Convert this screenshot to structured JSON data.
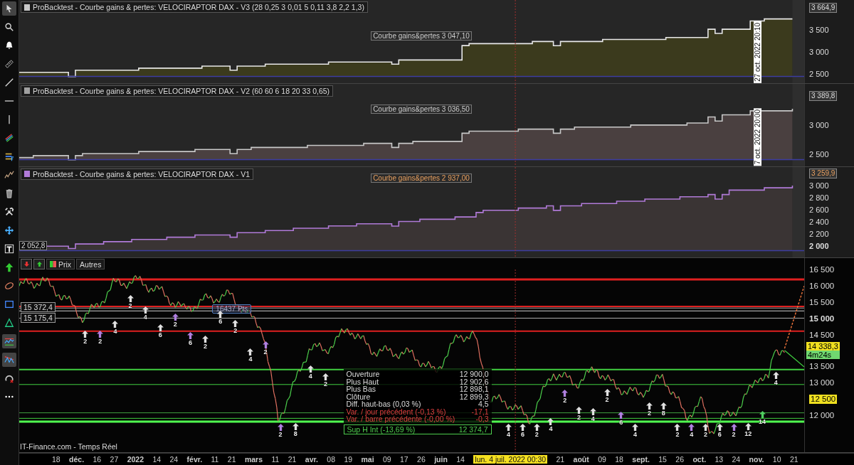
{
  "toolbar": [
    {
      "kind": "cursor",
      "selected": true
    },
    {
      "kind": "search",
      "selected": false
    },
    {
      "kind": "bell",
      "selected": false
    },
    {
      "kind": "ruler",
      "selected": false
    },
    {
      "kind": "line",
      "selected": false
    },
    {
      "kind": "hline",
      "selected": false
    },
    {
      "kind": "vline",
      "selected": false
    },
    {
      "kind": "channel",
      "selected": false
    },
    {
      "kind": "fibonacci",
      "selected": false
    },
    {
      "kind": "wave",
      "selected": false
    },
    {
      "kind": "trash",
      "selected": false
    },
    {
      "kind": "tools",
      "selected": false
    },
    {
      "kind": "move",
      "selected": false
    },
    {
      "kind": "text",
      "selected": false
    },
    {
      "kind": "arrow",
      "selected": false
    },
    {
      "kind": "ellipse",
      "selected": false
    },
    {
      "kind": "rectangle",
      "selected": false
    },
    {
      "kind": "triangle",
      "selected": false
    },
    {
      "kind": "trend",
      "selected": true
    },
    {
      "kind": "wavetrend",
      "selected": true
    },
    {
      "kind": "gauge",
      "selected": false
    },
    {
      "kind": "more",
      "selected": false
    }
  ],
  "panels": [
    {
      "title": "ProBacktest - Courbe gains & pertes: VELOCIRAPTOR DAX - V3 (28 0,25 3 0,01 5 0,11 3,8 2,2 1,3)",
      "color": "#c8c8c8",
      "label": "Courbe gains&pertes",
      "label_value": "3 047,10",
      "last_value": "3 664,9",
      "date_marker": "27 oct. 2022 20:10",
      "yticks": [
        "3 500",
        "3 000",
        "2 500"
      ]
    },
    {
      "title": "ProBacktest - Courbe gains & pertes: VELOCIRAPTOR DAX - V2 (60 60 6 18 20 33 0,65)",
      "color": "#a0a0a0",
      "label": "Courbe gains&pertes",
      "label_value": "3 036,50",
      "last_value": "3 389,8",
      "date_marker": "7 oct. 2022 20:00",
      "yticks": [
        "3 000",
        "2 500"
      ]
    },
    {
      "title": "ProBacktest - Courbe gains & pertes: VELOCIRAPTOR DAX - V1",
      "color": "#b07ad8",
      "label": "Courbe gains&pertes",
      "label_value": "2 937,00",
      "last_value": "3 259,9",
      "start_value": "2 052,8",
      "yticks": [
        "3 000",
        "2 800",
        "2 600",
        "2 400",
        "2 200",
        "2 000"
      ]
    }
  ],
  "price_panel": {
    "tabs": [
      {
        "label": "Prix"
      },
      {
        "label": "Autres"
      }
    ],
    "level_labels": [
      "15 372,4",
      "15 175,4"
    ],
    "measure": "16437 Pts",
    "yticks": [
      {
        "label": "16 500",
        "kind": "tick"
      },
      {
        "label": "16 000",
        "kind": "tick"
      },
      {
        "label": "15 500",
        "kind": "tick"
      },
      {
        "label": "15 000",
        "kind": "bold"
      },
      {
        "label": "14 500",
        "kind": "tick"
      },
      {
        "label": "13 500",
        "kind": "tick"
      },
      {
        "label": "13 000",
        "kind": "tick"
      },
      {
        "label": "12 500",
        "kind": "highlight"
      },
      {
        "label": "12 000",
        "kind": "tick"
      }
    ],
    "current_price": "14 338,3",
    "timer": "4m24s",
    "tooltip": [
      {
        "label": "Ouverture",
        "value": "12 900,0",
        "kind": "neutral"
      },
      {
        "label": "Plus Haut",
        "value": "12 902,6",
        "kind": "neutral"
      },
      {
        "label": "Plus Bas",
        "value": "12 898,1",
        "kind": "neutral"
      },
      {
        "label": "Clôture",
        "value": "12 899,3",
        "kind": "neutral"
      },
      {
        "label": "Diff. haut-bas (0,03 %)",
        "value": "4,5",
        "kind": "neutral"
      },
      {
        "label": "Var. / jour précédent (-0,13 %)",
        "value": "-17,1",
        "kind": "negative"
      },
      {
        "label": "Var. / barre précédente (-0,00 %)",
        "value": "-0,3",
        "kind": "negative"
      },
      {
        "label": "Sup H Int (-13,69 %)",
        "value": "12 374,7",
        "kind": "support"
      }
    ],
    "markers": [
      {
        "label": "2",
        "color": "#e0e0e0"
      },
      {
        "label": "2",
        "color": "#b080e0"
      },
      {
        "label": "4",
        "color": "#e0e0e0"
      },
      {
        "label": "2",
        "color": "#e0e0e0"
      },
      {
        "label": "4",
        "color": "#e0e0e0"
      },
      {
        "label": "6",
        "color": "#e0e0e0"
      },
      {
        "label": "2",
        "color": "#b080e0"
      },
      {
        "label": "6",
        "color": "#b080e0"
      },
      {
        "label": "2",
        "color": "#e0e0e0"
      },
      {
        "label": "6",
        "color": "#e0e0e0"
      },
      {
        "label": "2",
        "color": "#e0e0e0"
      },
      {
        "label": "4",
        "color": "#e0e0e0"
      },
      {
        "label": "2",
        "color": "#b080e0"
      },
      {
        "label": "2",
        "color": "#b080e0"
      },
      {
        "label": "8",
        "color": "#e0e0e0"
      },
      {
        "label": "4",
        "color": "#e0e0e0"
      },
      {
        "label": "2",
        "color": "#e0e0e0"
      },
      {
        "label": "4",
        "color": "#e0e0e0"
      },
      {
        "label": "6",
        "color": "#e0e0e0"
      },
      {
        "label": "2",
        "color": "#e0e0e0"
      },
      {
        "label": "4",
        "color": "#e0e0e0"
      },
      {
        "label": "2",
        "color": "#b080e0"
      },
      {
        "label": "2",
        "color": "#e0e0e0"
      },
      {
        "label": "4",
        "color": "#e0e0e0"
      },
      {
        "label": "2",
        "color": "#e0e0e0"
      },
      {
        "label": "6",
        "color": "#b080e0"
      },
      {
        "label": "4",
        "color": "#e0e0e0"
      },
      {
        "label": "2",
        "color": "#e0e0e0"
      },
      {
        "label": "8",
        "color": "#e0e0e0"
      },
      {
        "label": "2",
        "color": "#e0e0e0"
      },
      {
        "label": "4",
        "color": "#b080e0"
      },
      {
        "label": "2",
        "color": "#e0e0e0"
      },
      {
        "label": "6",
        "color": "#e0e0e0"
      },
      {
        "label": "2",
        "color": "#b080e0"
      },
      {
        "label": "12",
        "color": "#e0e0e0"
      },
      {
        "label": "14",
        "color": "#50d060"
      },
      {
        "label": "4",
        "color": "#e0e0e0"
      }
    ],
    "source": "IT-Finance.com - Temps Réel"
  },
  "x_axis": [
    {
      "label": "18",
      "kind": "day"
    },
    {
      "label": "déc.",
      "kind": "month"
    },
    {
      "label": "16",
      "kind": "day"
    },
    {
      "label": "27",
      "kind": "day"
    },
    {
      "label": "2022",
      "kind": "month"
    },
    {
      "label": "14",
      "kind": "day"
    },
    {
      "label": "24",
      "kind": "day"
    },
    {
      "label": "févr.",
      "kind": "month"
    },
    {
      "label": "11",
      "kind": "day"
    },
    {
      "label": "21",
      "kind": "day"
    },
    {
      "label": "mars",
      "kind": "month"
    },
    {
      "label": "11",
      "kind": "day"
    },
    {
      "label": "21",
      "kind": "day"
    },
    {
      "label": "avr.",
      "kind": "month"
    },
    {
      "label": "08",
      "kind": "day"
    },
    {
      "label": "19",
      "kind": "day"
    },
    {
      "label": "mai",
      "kind": "month"
    },
    {
      "label": "09",
      "kind": "day"
    },
    {
      "label": "17",
      "kind": "day"
    },
    {
      "label": "26",
      "kind": "day"
    },
    {
      "label": "juin",
      "kind": "month"
    },
    {
      "label": "14",
      "kind": "day"
    },
    {
      "label": "lun. 4 juil. 2022 00:30",
      "kind": "cursor"
    },
    {
      "label": "21",
      "kind": "day"
    },
    {
      "label": "août",
      "kind": "month"
    },
    {
      "label": "09",
      "kind": "day"
    },
    {
      "label": "18",
      "kind": "day"
    },
    {
      "label": "sept.",
      "kind": "month"
    },
    {
      "label": "15",
      "kind": "day"
    },
    {
      "label": "26",
      "kind": "day"
    },
    {
      "label": "oct.",
      "kind": "month"
    },
    {
      "label": "13",
      "kind": "day"
    },
    {
      "label": "24",
      "kind": "day"
    },
    {
      "label": "nov.",
      "kind": "month"
    },
    {
      "label": "10",
      "kind": "day"
    },
    {
      "label": "21",
      "kind": "day"
    }
  ]
}
